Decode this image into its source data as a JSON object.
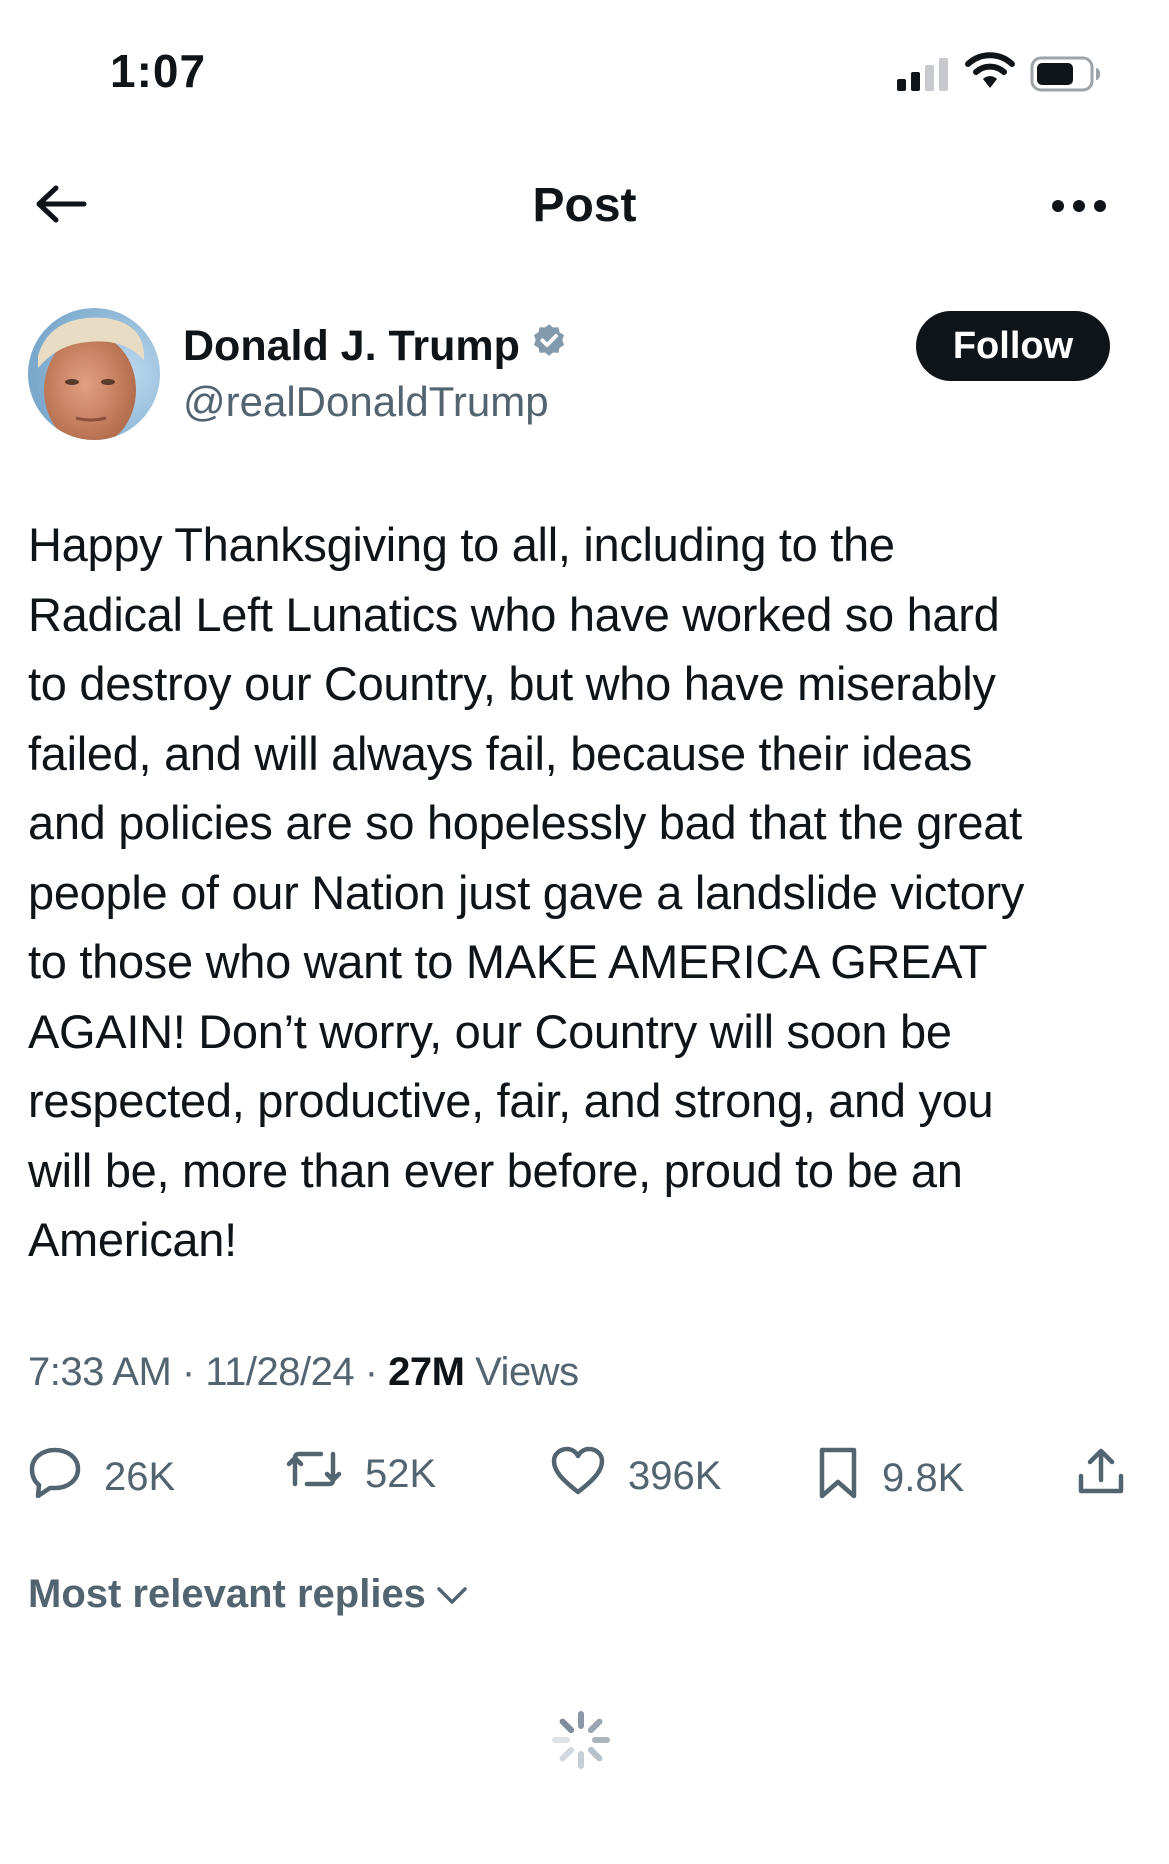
{
  "status_bar": {
    "time": "1:07",
    "signal_icon": "cellular-signal-icon",
    "wifi_icon": "wifi-icon",
    "battery_icon": "battery-icon"
  },
  "header": {
    "title": "Post",
    "back_icon": "back-arrow-icon",
    "more_icon": "more-options-icon"
  },
  "author": {
    "name": "Donald J. Trump",
    "handle": "@realDonaldTrump",
    "verified_icon": "verified-badge-icon",
    "follow_label": "Follow"
  },
  "post": {
    "text": "Happy Thanksgiving to all, including to the\nRadical Left Lunatics who have worked so hard\nto destroy our Country, but who have miserably\nfailed, and will always fail, because their ideas\nand policies are so hopelessly bad that the great\npeople of our Nation just gave a landslide victory\nto those who want to MAKE AMERICA GREAT\nAGAIN! Don’t worry, our Country will soon be\nrespected, productive, fair, and strong, and you\nwill be, more than ever before, proud to be an\nAmerican!",
    "time": "7:33 AM",
    "date": "11/28/24",
    "views_count": "27M",
    "views_label": "Views",
    "separator": "·"
  },
  "actions": {
    "replies": "26K",
    "reposts": "52K",
    "likes": "396K",
    "bookmarks": "9.8K"
  },
  "replies_sort": {
    "label": "Most relevant replies"
  },
  "colors": {
    "text_primary": "#0f1419",
    "text_secondary": "#536471",
    "verified": "#829aab"
  }
}
